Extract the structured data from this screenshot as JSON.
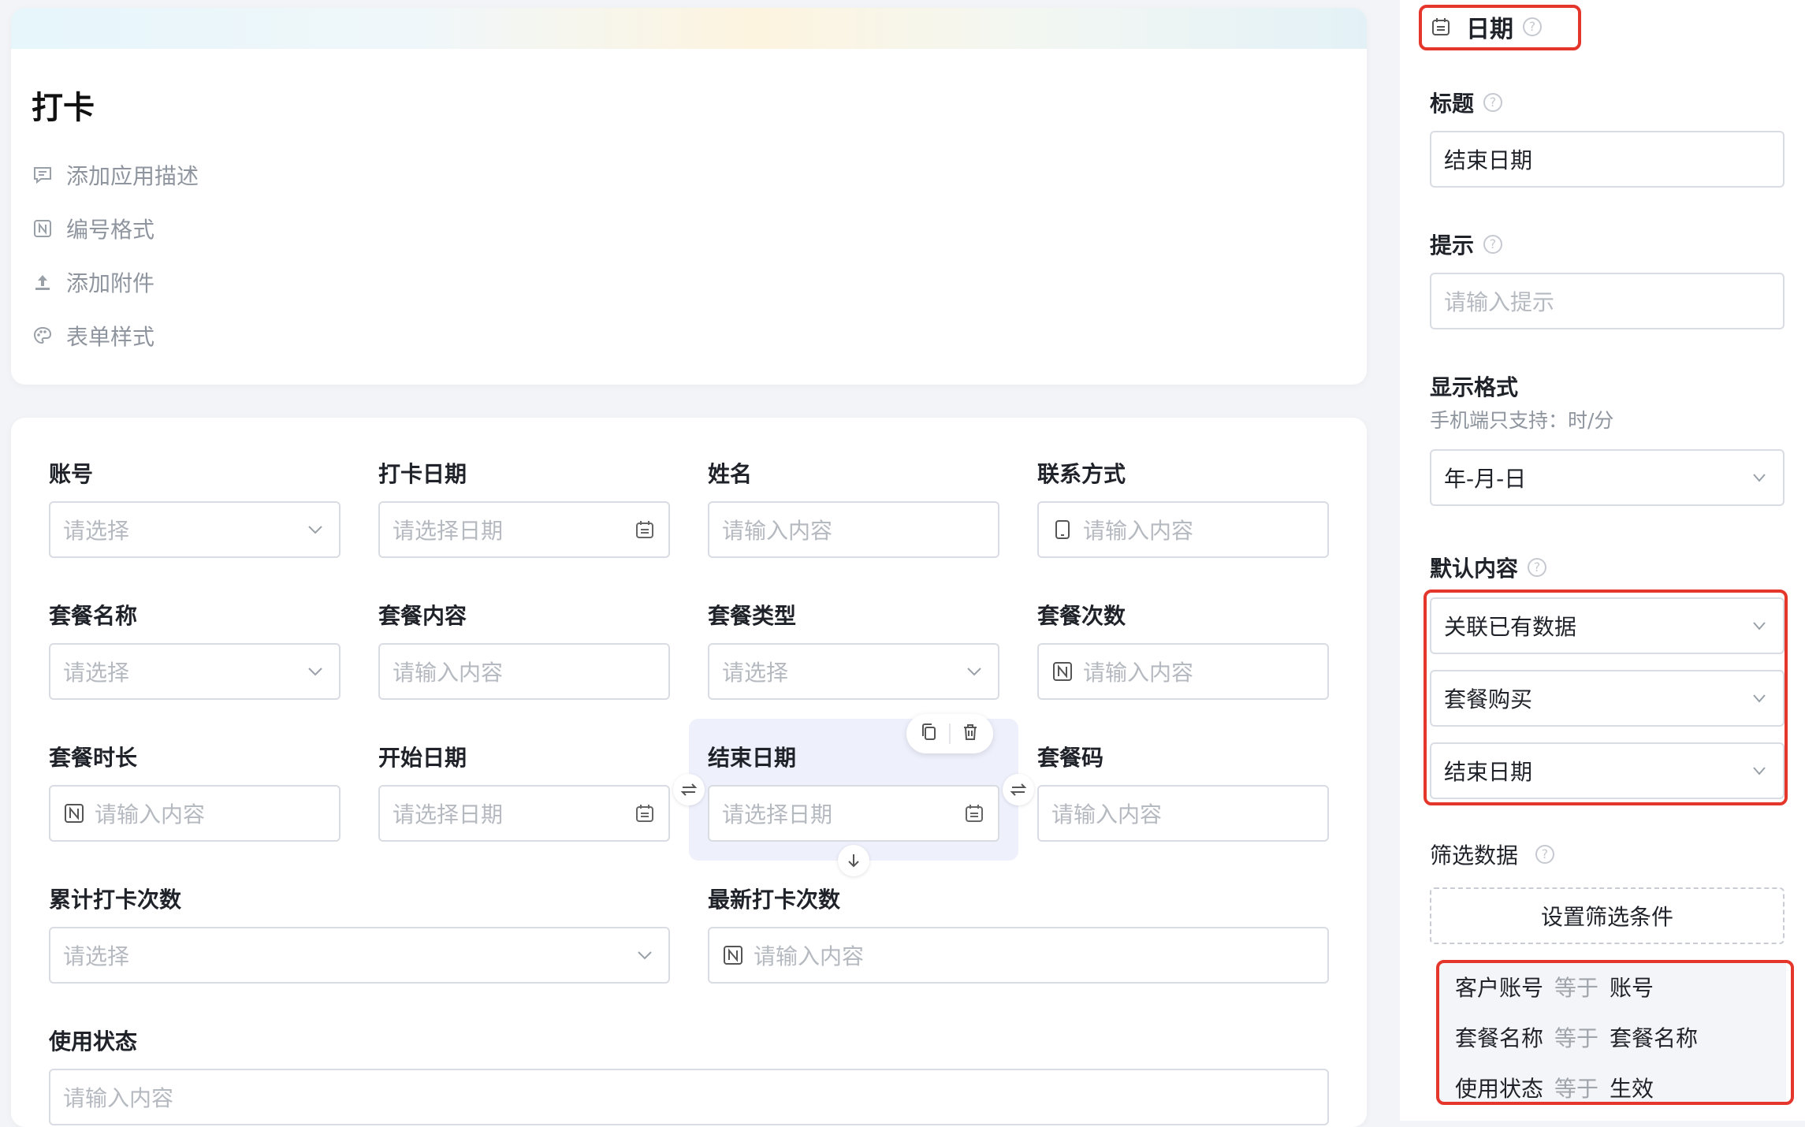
{
  "header": {
    "title": "打卡",
    "meta_items": [
      {
        "icon": "comment-icon",
        "label": "添加应用描述"
      },
      {
        "icon": "number-format-icon",
        "label": "编号格式"
      },
      {
        "icon": "upload-icon",
        "label": "添加附件"
      },
      {
        "icon": "palette-icon",
        "label": "表单样式"
      }
    ]
  },
  "form": {
    "fields": [
      {
        "label": "账号",
        "placeholder": "请选择",
        "type": "select"
      },
      {
        "label": "打卡日期",
        "placeholder": "请选择日期",
        "type": "date"
      },
      {
        "label": "姓名",
        "placeholder": "请输入内容",
        "type": "text"
      },
      {
        "label": "联系方式",
        "placeholder": "请输入内容",
        "type": "phone"
      },
      {
        "label": "套餐名称",
        "placeholder": "请选择",
        "type": "select"
      },
      {
        "label": "套餐内容",
        "placeholder": "请输入内容",
        "type": "text"
      },
      {
        "label": "套餐类型",
        "placeholder": "请选择",
        "type": "select"
      },
      {
        "label": "套餐次数",
        "placeholder": "请输入内容",
        "type": "number"
      },
      {
        "label": "套餐时长",
        "placeholder": "请输入内容",
        "type": "number"
      },
      {
        "label": "开始日期",
        "placeholder": "请选择日期",
        "type": "date"
      },
      {
        "label": "结束日期",
        "placeholder": "请选择日期",
        "type": "date",
        "selected": true
      },
      {
        "label": "套餐码",
        "placeholder": "请输入内容",
        "type": "text"
      },
      {
        "label": "累计打卡次数",
        "placeholder": "请选择",
        "type": "select"
      },
      {
        "label": "最新打卡次数",
        "placeholder": "请输入内容",
        "type": "number"
      },
      {
        "label": "使用状态",
        "placeholder": "请输入内容",
        "type": "text"
      }
    ]
  },
  "panel": {
    "component_type": "日期",
    "title_label": "标题",
    "title_value": "结束日期",
    "hint_label": "提示",
    "hint_placeholder": "请输入提示",
    "format_label": "显示格式",
    "format_note": "手机端只支持：时/分",
    "format_value": "年-月-日",
    "default_label": "默认内容",
    "default_source": "关联已有数据",
    "default_form": "套餐购买",
    "default_field": "结束日期",
    "filter_label": "筛选数据",
    "filter_button": "设置筛选条件",
    "conditions": [
      {
        "left": "客户账号",
        "op": "等于",
        "right": "账号"
      },
      {
        "left": "套餐名称",
        "op": "等于",
        "right": "套餐名称"
      },
      {
        "left": "使用状态",
        "op": "等于",
        "right": "生效"
      }
    ]
  },
  "colors": {
    "highlight_red": "#e4362b",
    "selected_bg": "#eef0fc",
    "border": "#d9dce2",
    "placeholder": "#b5b9c0"
  }
}
